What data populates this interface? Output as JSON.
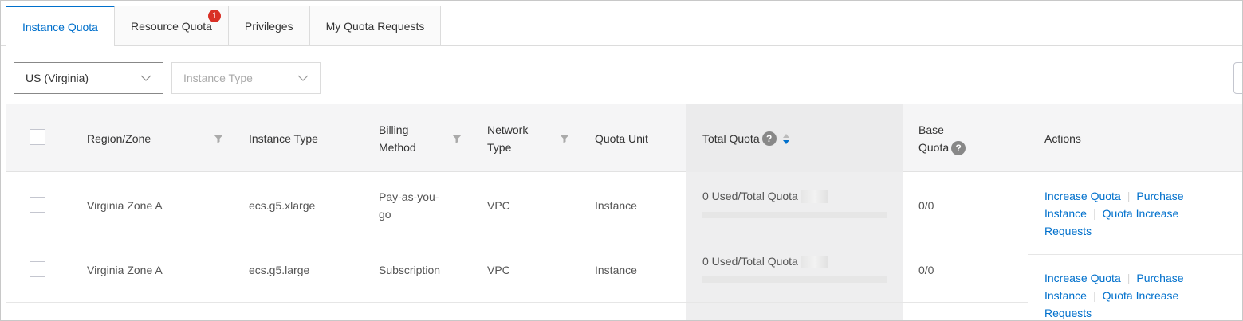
{
  "tabs": [
    {
      "label": "Instance Quota",
      "active": true
    },
    {
      "label": "Resource Quota",
      "badge": "1"
    },
    {
      "label": "Privileges"
    },
    {
      "label": "My Quota Requests"
    }
  ],
  "filters": {
    "region": {
      "value": "US (Virginia)"
    },
    "instance_type": {
      "placeholder": "Instance Type"
    }
  },
  "table": {
    "headers": {
      "region_zone": "Region/Zone",
      "instance_type": "Instance Type",
      "billing_method_1": "Billing",
      "billing_method_2": "Method",
      "network_type_1": "Network",
      "network_type_2": "Type",
      "quota_unit": "Quota Unit",
      "total_quota": "Total Quota",
      "base_quota_1": "Base",
      "base_quota_2": "Quota",
      "actions": "Actions"
    },
    "rows": [
      {
        "region_zone": "Virginia Zone A",
        "instance_type": "ecs.g5.xlarge",
        "billing_1": "Pay-as-you-",
        "billing_2": "go",
        "network_type": "VPC",
        "quota_unit": "Instance",
        "total_quota": "0 Used/Total Quota",
        "base_quota": "0/0",
        "actions": {
          "increase": "Increase Quota",
          "purchase_1": "Purchase",
          "purchase_2": "Instance",
          "requests_1": "Quota Increase",
          "requests_2": "Requests"
        }
      },
      {
        "region_zone": "Virginia Zone A",
        "instance_type": "ecs.g5.large",
        "billing_1": "Subscription",
        "billing_2": "",
        "network_type": "VPC",
        "quota_unit": "Instance",
        "total_quota": "0 Used/Total Quota",
        "base_quota": "0/0",
        "actions": {
          "increase": "Increase Quota",
          "purchase_1": "Purchase",
          "purchase_2": "Instance",
          "requests_1": "Quota Increase",
          "requests_2": "Requests"
        }
      }
    ]
  },
  "icons": {
    "help": "?",
    "dropdown": "chevron-down-icon",
    "filter": "filter-icon",
    "sort": "sort-icon"
  },
  "colors": {
    "accent": "#0070cc",
    "badge": "#d93026"
  }
}
